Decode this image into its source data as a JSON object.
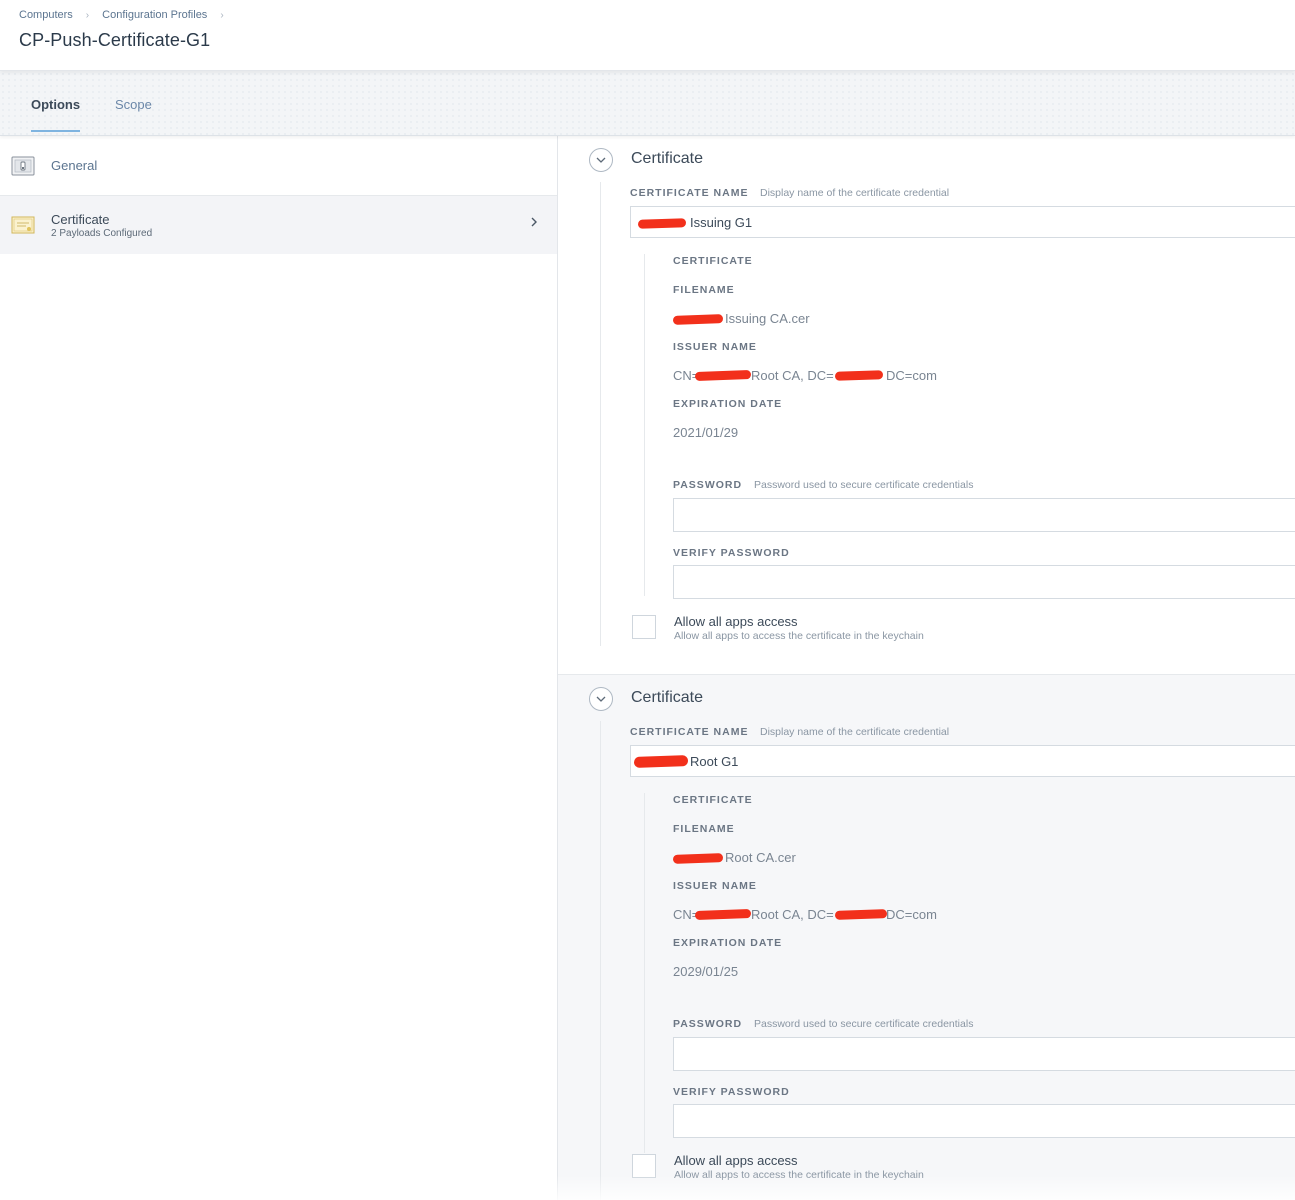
{
  "breadcrumb": {
    "items": [
      "Computers",
      "Configuration Profiles"
    ]
  },
  "page": {
    "title": "CP-Push-Certificate-G1"
  },
  "tabs": [
    {
      "label": "Options",
      "active": true
    },
    {
      "label": "Scope",
      "active": false
    }
  ],
  "sidebar": {
    "items": [
      {
        "label": "General",
        "icon": "general-settings-icon"
      },
      {
        "label": "Certificate",
        "sublabel": "2 Payloads Configured",
        "icon": "certificate-icon",
        "selected": true
      }
    ]
  },
  "payloads": [
    {
      "title": "Certificate",
      "certificate_name_label": "CERTIFICATE NAME",
      "certificate_name_hint": "Display name of the certificate credential",
      "certificate_name_value": "Issuing G1",
      "certificate_section_label": "CERTIFICATE",
      "filename_label": "FILENAME",
      "filename_value": "Issuing CA.cer",
      "issuer_name_label": "ISSUER NAME",
      "issuer_prefix": "CN=",
      "issuer_middle": "Root CA, DC=",
      "issuer_suffix": "DC=com",
      "expiration_label": "EXPIRATION DATE",
      "expiration_value": "2021/01/29",
      "password_label": "PASSWORD",
      "password_hint": "Password used to secure certificate credentials",
      "password_value": "",
      "verify_password_label": "VERIFY PASSWORD",
      "verify_password_value": "",
      "allow_access_label": "Allow all apps access",
      "allow_access_hint": "Allow all apps to access the certificate in the keychain",
      "allow_access_checked": false
    },
    {
      "title": "Certificate",
      "certificate_name_label": "CERTIFICATE NAME",
      "certificate_name_hint": "Display name of the certificate credential",
      "certificate_name_value": "Root G1",
      "certificate_section_label": "CERTIFICATE",
      "filename_label": "FILENAME",
      "filename_value": "Root CA.cer",
      "issuer_name_label": "ISSUER NAME",
      "issuer_prefix": "CN=",
      "issuer_middle": "Root CA, DC=",
      "issuer_suffix": "DC=com",
      "expiration_label": "EXPIRATION DATE",
      "expiration_value": "2029/01/25",
      "password_label": "PASSWORD",
      "password_hint": "Password used to secure certificate credentials",
      "password_value": "",
      "verify_password_label": "VERIFY PASSWORD",
      "verify_password_value": "",
      "allow_access_label": "Allow all apps access",
      "allow_access_hint": "Allow all apps to access the certificate in the keychain",
      "allow_access_checked": false
    }
  ],
  "colors": {
    "accent_underline": "#7fb4e0",
    "link": "#5c7590",
    "redaction": "#f2301b",
    "selected_row": "#f3f4f7"
  }
}
